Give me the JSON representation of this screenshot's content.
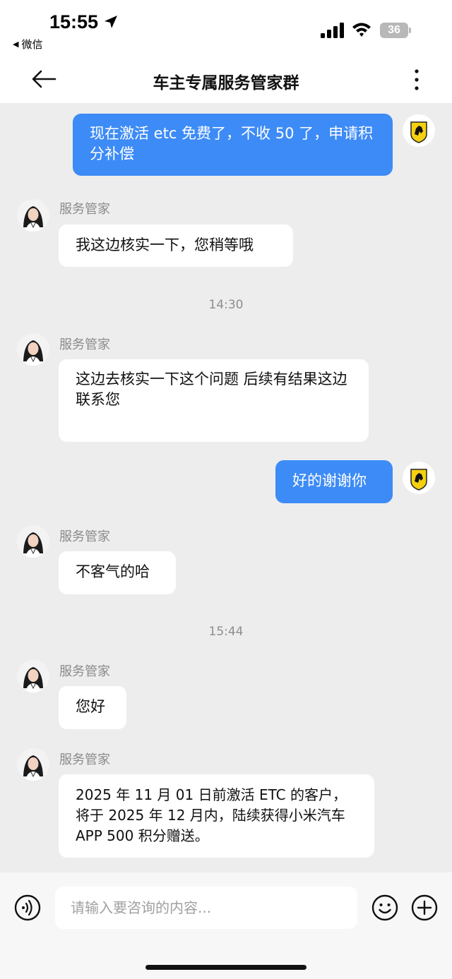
{
  "status_bar": {
    "time": "15:55",
    "back_app": "微信",
    "battery": "36"
  },
  "nav": {
    "title": "车主专属服务管家群"
  },
  "messages": [
    {
      "side": "out",
      "text": "现在激活 etc 免费了，不收 50 了，申请积分补偿"
    },
    {
      "side": "in",
      "sender": "服务管家",
      "text": "我这边核实一下，您稍等哦"
    },
    {
      "type": "time",
      "text": "14:30"
    },
    {
      "side": "in",
      "sender": "服务管家",
      "text": "这边去核实一下这个问题 后续有结果这边联系您"
    },
    {
      "side": "out",
      "text": "好的谢谢你"
    },
    {
      "side": "in",
      "sender": "服务管家",
      "text": "不客气的哈"
    },
    {
      "type": "time",
      "text": "15:44"
    },
    {
      "side": "in",
      "sender": "服务管家",
      "text": "您好"
    },
    {
      "side": "in",
      "sender": "服务管家",
      "text": "2025 年 11 月 01 日前激活 ETC 的客户，将于 2025 年 12 月内，陆续获得小米汽车 APP 500 积分赠送。"
    }
  ],
  "input": {
    "placeholder": "请输入要咨询的内容..."
  },
  "icons": {
    "voice": "voice-icon",
    "emoji": "emoji-icon",
    "plus": "plus-icon",
    "back": "back-arrow-icon",
    "more": "more-icon"
  },
  "colors": {
    "out_bubble": "#3d8bf6",
    "in_bubble": "#ffffff",
    "background": "#ededed"
  }
}
